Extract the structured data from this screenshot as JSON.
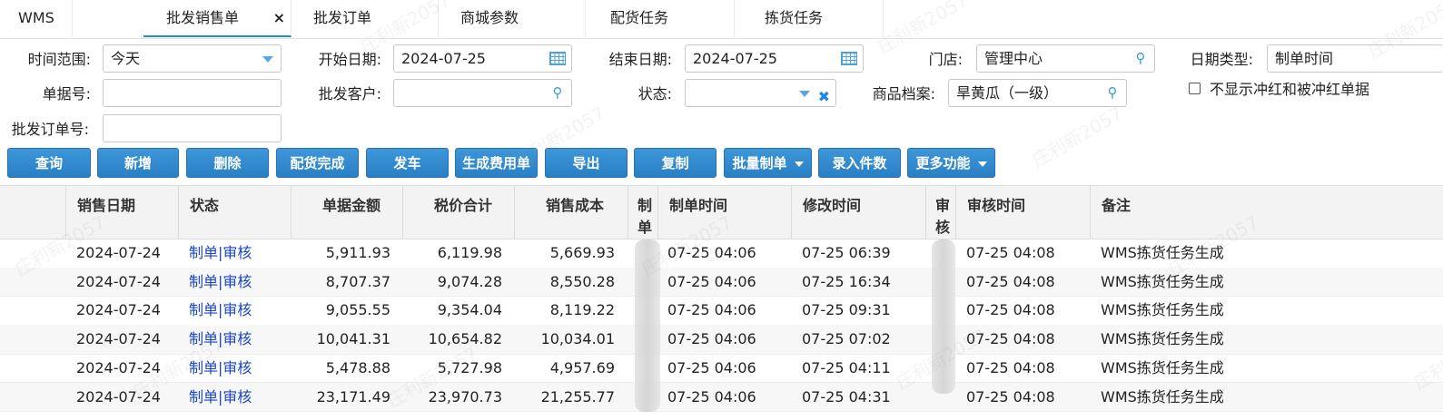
{
  "tabs": [
    {
      "label": "WMS",
      "active": false
    },
    {
      "label": "批发销售单",
      "active": true,
      "close": "×"
    },
    {
      "label": "批发订单",
      "active": false
    },
    {
      "label": "商城参数",
      "active": false
    },
    {
      "label": "配货任务",
      "active": false
    },
    {
      "label": "拣货任务",
      "active": false
    }
  ],
  "filters": {
    "time_range": {
      "label": "时间范围:",
      "value": "今天"
    },
    "start_date": {
      "label": "开始日期:",
      "value": "2024-07-25"
    },
    "end_date": {
      "label": "结束日期:",
      "value": "2024-07-25"
    },
    "store": {
      "label": "门店:",
      "value": "管理中心"
    },
    "date_type": {
      "label": "日期类型:",
      "value": "制单时间"
    },
    "doc_no": {
      "label": "单据号:",
      "value": ""
    },
    "customer": {
      "label": "批发客户:",
      "value": ""
    },
    "status": {
      "label": "状态:",
      "value": ""
    },
    "product": {
      "label": "商品档案:",
      "value": "旱黄瓜（一级）"
    },
    "hide_red": {
      "label": "不显示冲红和被冲红单据",
      "checked": false
    },
    "order_no": {
      "label": "批发订单号:",
      "value": ""
    }
  },
  "toolbar": [
    "查询",
    "新增",
    "删除",
    "配货完成",
    "发车",
    "生成费用单",
    "导出",
    "复制",
    "批量制单",
    "录入件数",
    "更多功能"
  ],
  "columns": [
    "销售日期",
    "状态",
    "单据金额",
    "税价合计",
    "销售成本",
    "制单",
    "制单时间",
    "修改时间",
    "审核",
    "审核时间",
    "备注"
  ],
  "status_parts": {
    "made": "制单",
    "sep": "|",
    "audited": "审核"
  },
  "rows": [
    {
      "date": "2024-07-24",
      "amount": "5,911.93",
      "tax_total": "6,119.98",
      "cost": "5,669.93",
      "created": "07-25 04:06",
      "modified": "07-25 06:39",
      "audited_at": "07-25 04:08",
      "note": "WMS拣货任务生成"
    },
    {
      "date": "2024-07-24",
      "amount": "8,707.37",
      "tax_total": "9,074.28",
      "cost": "8,550.28",
      "created": "07-25 04:06",
      "modified": "07-25 16:34",
      "audited_at": "07-25 04:08",
      "note": "WMS拣货任务生成"
    },
    {
      "date": "2024-07-24",
      "amount": "9,055.55",
      "tax_total": "9,354.04",
      "cost": "8,119.22",
      "created": "07-25 04:06",
      "modified": "07-25 09:31",
      "audited_at": "07-25 04:08",
      "note": "WMS拣货任务生成"
    },
    {
      "date": "2024-07-24",
      "amount": "10,041.31",
      "tax_total": "10,654.82",
      "cost": "10,034.01",
      "created": "07-25 04:06",
      "modified": "07-25 07:02",
      "audited_at": "07-25 04:08",
      "note": "WMS拣货任务生成"
    },
    {
      "date": "2024-07-24",
      "amount": "5,478.88",
      "tax_total": "5,727.98",
      "cost": "4,957.69",
      "created": "07-25 04:06",
      "modified": "07-25 04:11",
      "audited_at": "07-25 04:08",
      "note": "WMS拣货任务生成"
    },
    {
      "date": "2024-07-24",
      "amount": "23,171.49",
      "tax_total": "23,970.73",
      "cost": "21,255.77",
      "created": "07-25 04:06",
      "modified": "07-25 04:31",
      "audited_at": "07-25 04:08",
      "note": "WMS拣货任务生成"
    }
  ],
  "watermark": "庄利新2057",
  "colors": {
    "accent": "#1e88e5",
    "button": "#2a7fc4",
    "link": "#1a45c8"
  }
}
